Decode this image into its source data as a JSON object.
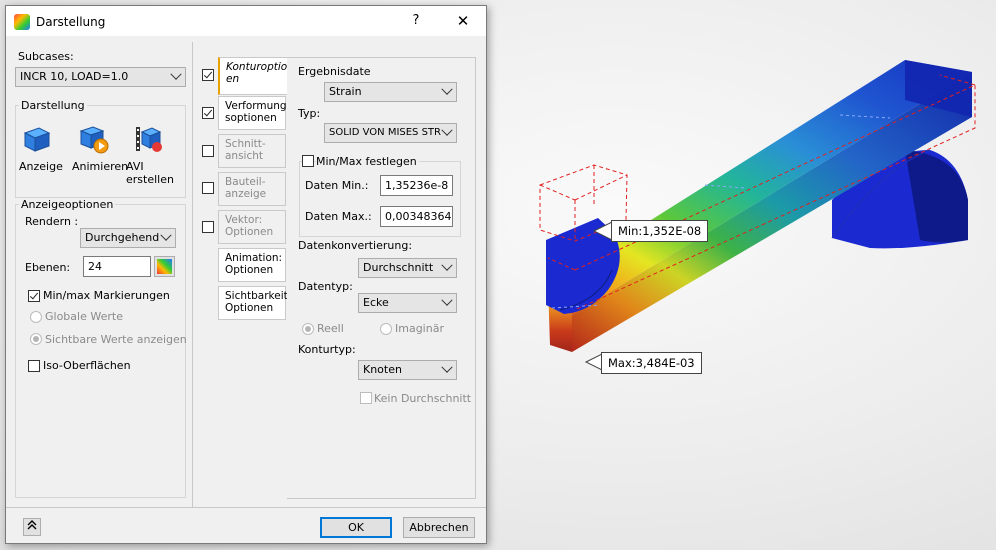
{
  "window": {
    "title": "Darstellung",
    "help_label": "?",
    "close_label": "✕"
  },
  "subcases": {
    "label": "Subcases:",
    "value": "INCR 10, LOAD=1.0"
  },
  "darstellung": {
    "title": "Darstellung",
    "buttons": [
      {
        "label": "Anzeige",
        "icon": "display-icon"
      },
      {
        "label": "Animieren",
        "icon": "animate-icon"
      },
      {
        "label": "AVI\nerstellen",
        "icon": "avi-icon"
      }
    ]
  },
  "anzeigeoptionen": {
    "title": "Anzeigeoptionen",
    "rendern_label": "Rendern :",
    "rendern_value": "Durchgehend",
    "ebenen_label": "Ebenen:",
    "ebenen_value": "24",
    "minmax_label": "Min/max Markierungen",
    "minmax_checked": true,
    "global_label": "Globale Werte",
    "visible_label": "Sichtbare Werte anzeigen",
    "iso_label": "Iso-Oberflächen",
    "iso_checked": false
  },
  "tabs": [
    {
      "label": "Konturoption en",
      "checked": true,
      "state": "active"
    },
    {
      "label": "Verformung soptionen",
      "checked": true,
      "state": "enabled"
    },
    {
      "label": "Schnitt- ansicht",
      "checked": false,
      "state": "inactive"
    },
    {
      "label": "Bauteil- anzeige",
      "checked": false,
      "state": "inactive"
    },
    {
      "label": "Vektor: Optionen",
      "checked": false,
      "state": "inactive"
    },
    {
      "label": "Animation: Optionen",
      "state": "enabled"
    },
    {
      "label": "Sichtbarkeit: Optionen",
      "state": "enabled"
    }
  ],
  "contour": {
    "ergebnis_label": "Ergebnisdate",
    "ergebnis_value": "Strain",
    "typ_label": "Typ:",
    "typ_value": "SOLID VON MISES STR",
    "minmax_fix_label": "Min/Max festlegen",
    "minmax_fix_checked": false,
    "daten_min_label": "Daten Min.:",
    "daten_min_value": "1,35236e-8",
    "daten_max_label": "Daten Max.:",
    "daten_max_value": "0,00348364",
    "konvertierung_label": "Datenkonvertierung:",
    "konvertierung_value": "Durchschnitt",
    "datentyp_label": "Datentyp:",
    "datentyp_value": "Ecke",
    "reell_label": "Reell",
    "imaginaer_label": "Imaginär",
    "konturtyp_label": "Konturtyp:",
    "konturtyp_value": "Knoten",
    "kein_durchschnitt_label": "Kein Durchschnitt"
  },
  "footer": {
    "ok_label": "OK",
    "cancel_label": "Abbrechen",
    "expand_icon": "double-chevron-up-icon"
  },
  "viewport": {
    "min_label": "Min:1,352E-08",
    "max_label": "Max:3,484E-03"
  }
}
